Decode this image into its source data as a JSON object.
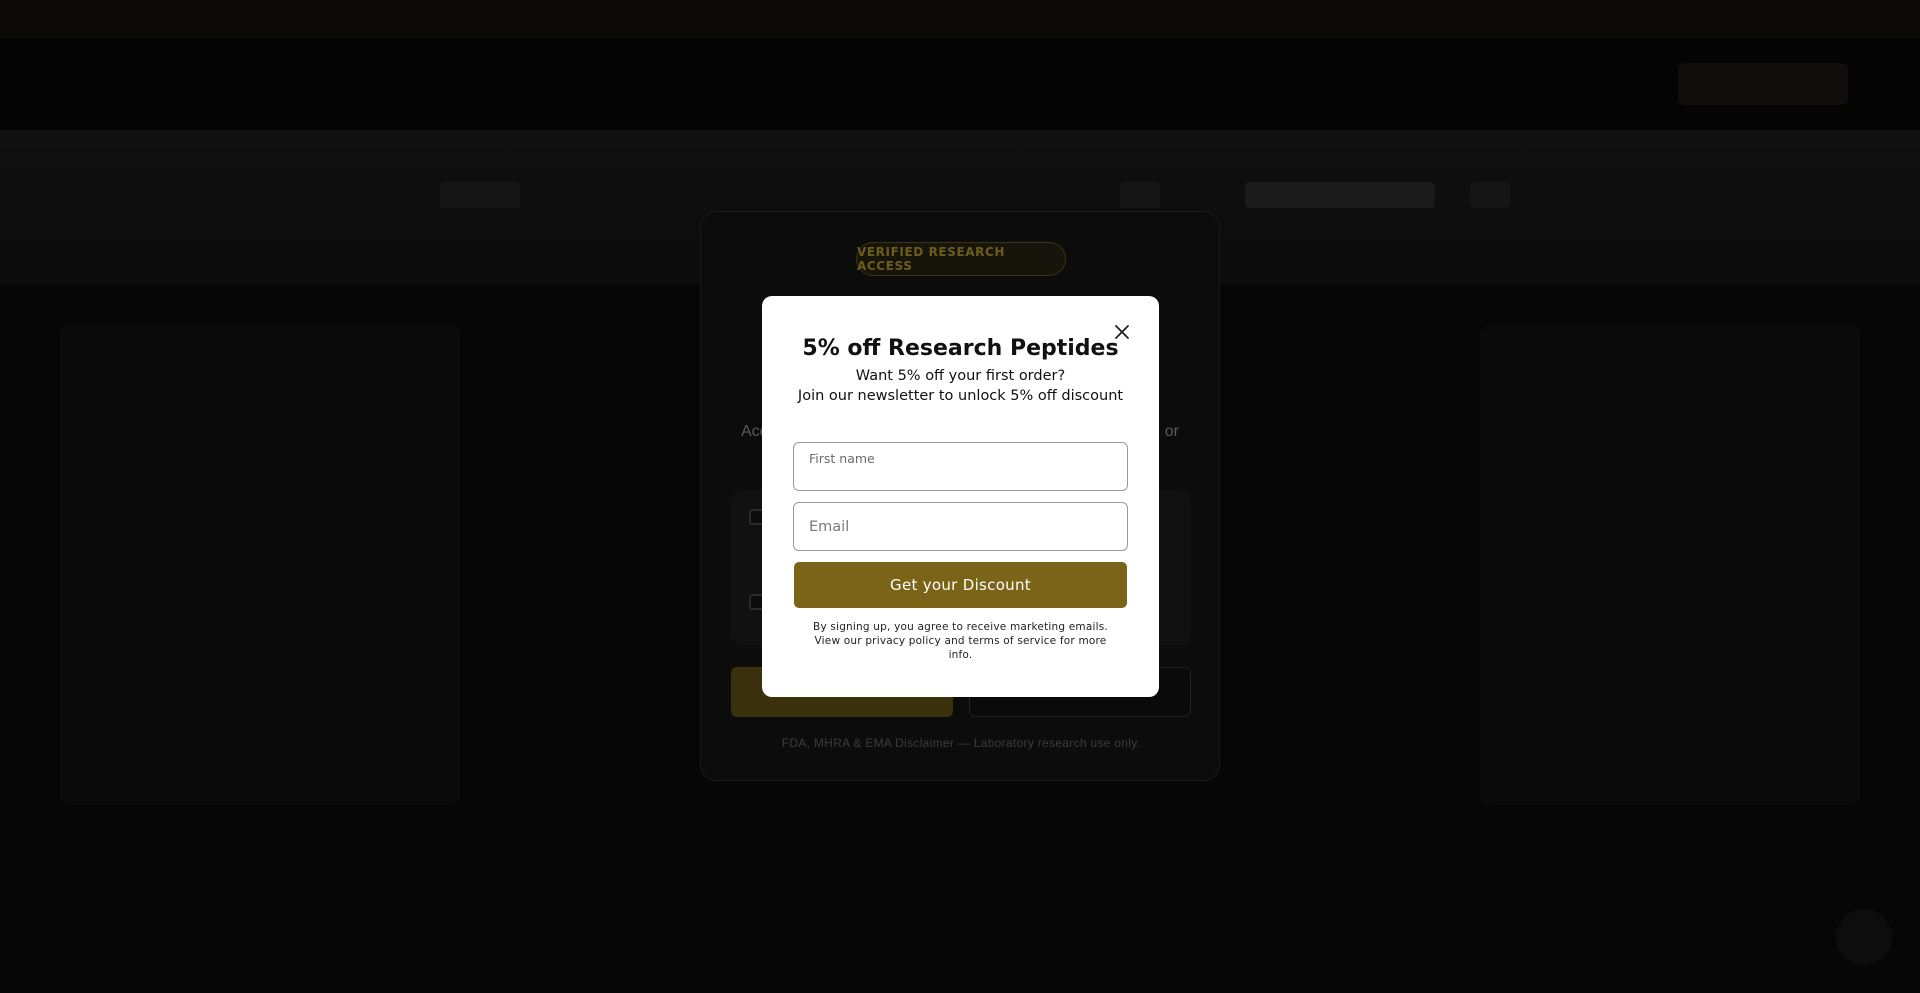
{
  "colors": {
    "overlay": "#050505",
    "gold_button": "#7b6418",
    "popup_bg": "#ffffff"
  },
  "age_gate": {
    "badge": "VERIFIED RESEARCH ACCESS",
    "text_left": "Acc",
    "text_right": "or",
    "disclaimer": "FDA, MHRA & EMA Disclaimer — Laboratory research use only."
  },
  "popup": {
    "close_icon": "close-icon",
    "title": "5% off Research Peptides",
    "subtitle_line1": "Want 5% off your first order?",
    "subtitle_line2": "Join our newsletter to unlock 5% off discount",
    "first_name_label": "First name",
    "first_name_value": "",
    "email_placeholder": "Email",
    "submit_label": "Get your Discount",
    "legal": "By signing up, you agree to receive marketing emails. View our privacy policy and terms of service for more info."
  }
}
